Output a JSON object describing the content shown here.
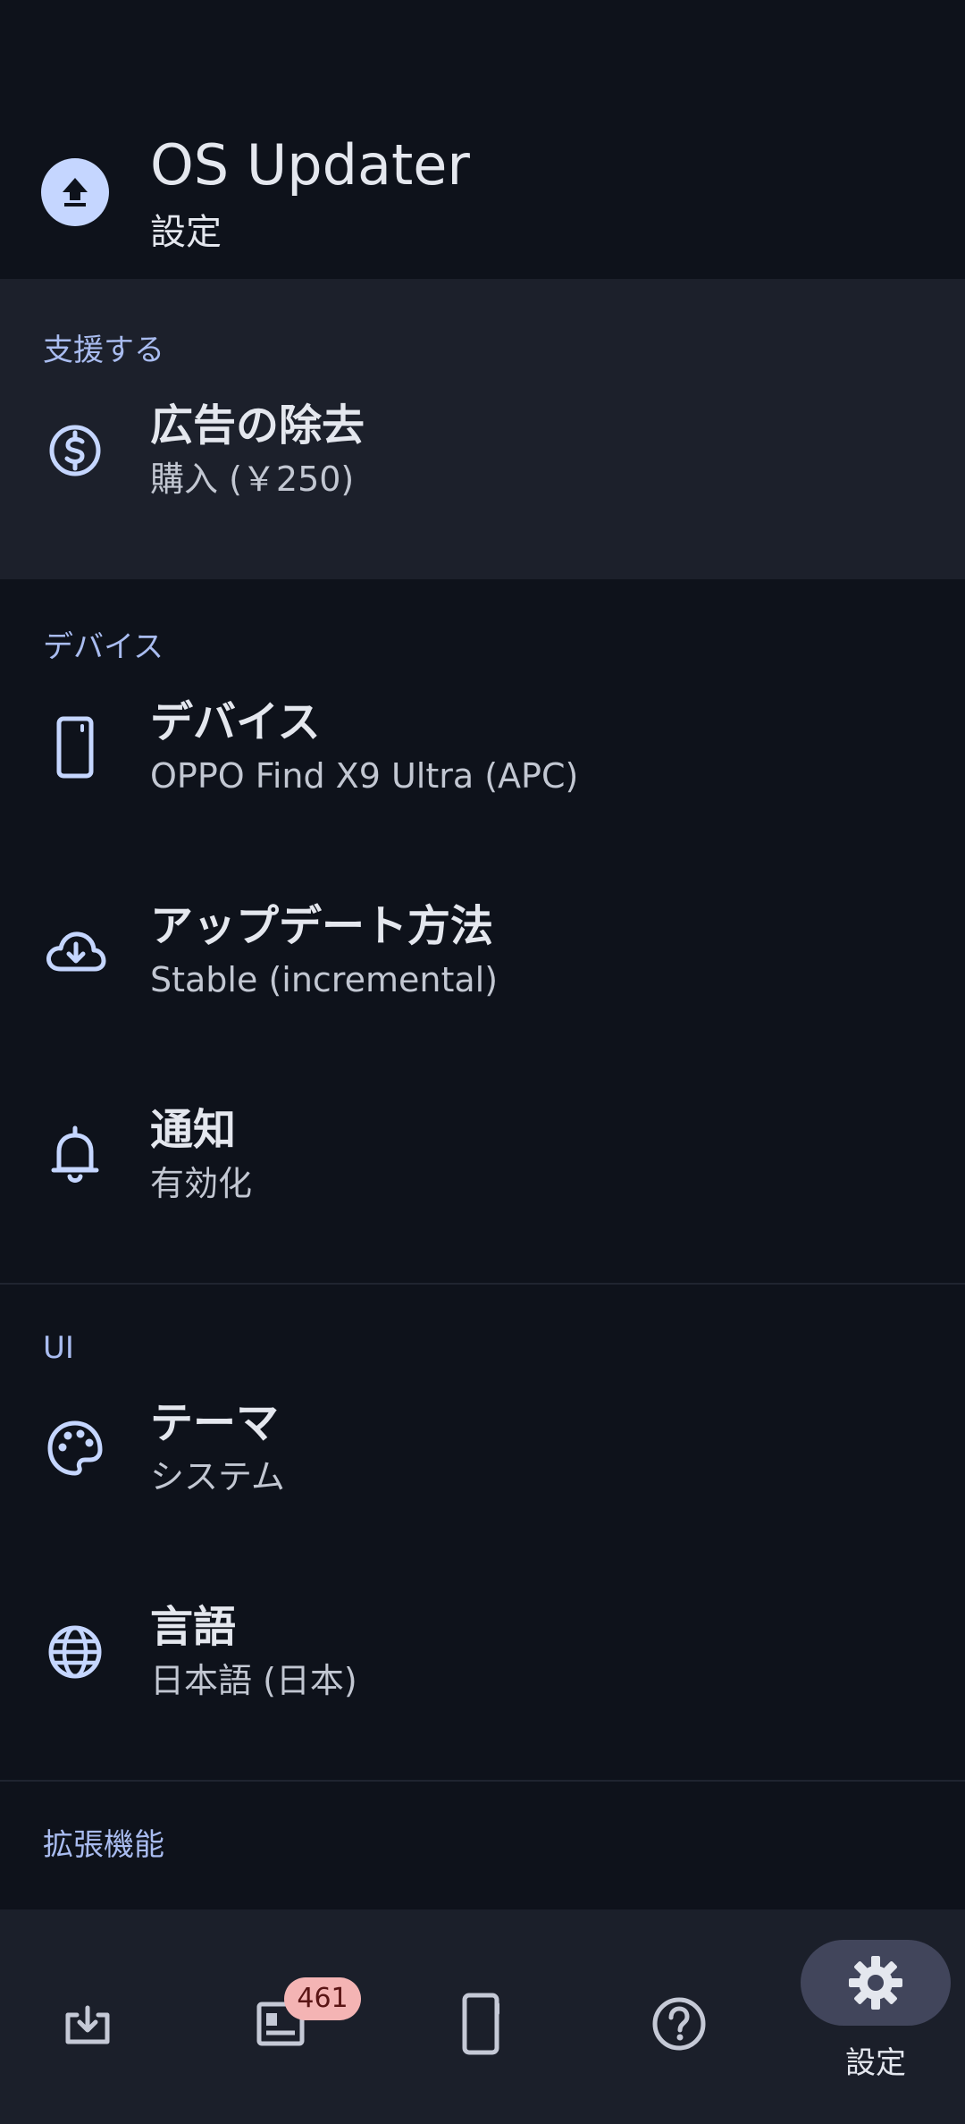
{
  "app": {
    "title": "OS Updater",
    "subtitle": "設定"
  },
  "sections": {
    "support": {
      "header": "支援する",
      "items": [
        {
          "title": "広告の除去",
          "summary": "購入 (￥250)",
          "icon": "dollar-circle-icon"
        }
      ]
    },
    "device": {
      "header": "デバイス",
      "items": [
        {
          "title": "デバイス",
          "summary": "OPPO Find X9 Ultra (APC)",
          "icon": "phone-icon"
        },
        {
          "title": "アップデート方法",
          "summary": "Stable (incremental)",
          "icon": "cloud-download-icon"
        },
        {
          "title": "通知",
          "summary": "有効化",
          "icon": "bell-icon"
        }
      ]
    },
    "ui": {
      "header": "UI",
      "items": [
        {
          "title": "テーマ",
          "summary": "システム",
          "icon": "palette-icon"
        },
        {
          "title": "言語",
          "summary": "日本語 (日本)",
          "icon": "globe-icon"
        }
      ]
    },
    "extensions": {
      "header": "拡張機能"
    }
  },
  "bottom_nav": {
    "items": [
      {
        "icon": "download-tray-icon"
      },
      {
        "icon": "news-icon",
        "badge": "461"
      },
      {
        "icon": "device-icon"
      },
      {
        "icon": "help-icon"
      },
      {
        "icon": "settings-gear-icon",
        "label": "設定",
        "selected": true
      }
    ]
  },
  "colors": {
    "background": "#0e121b",
    "section_highlight": "#1c202b",
    "accent": "#a9bcf0",
    "icon": "#c5d6ff",
    "badge": "#f4b4b4",
    "nav_pill": "#41455b"
  }
}
